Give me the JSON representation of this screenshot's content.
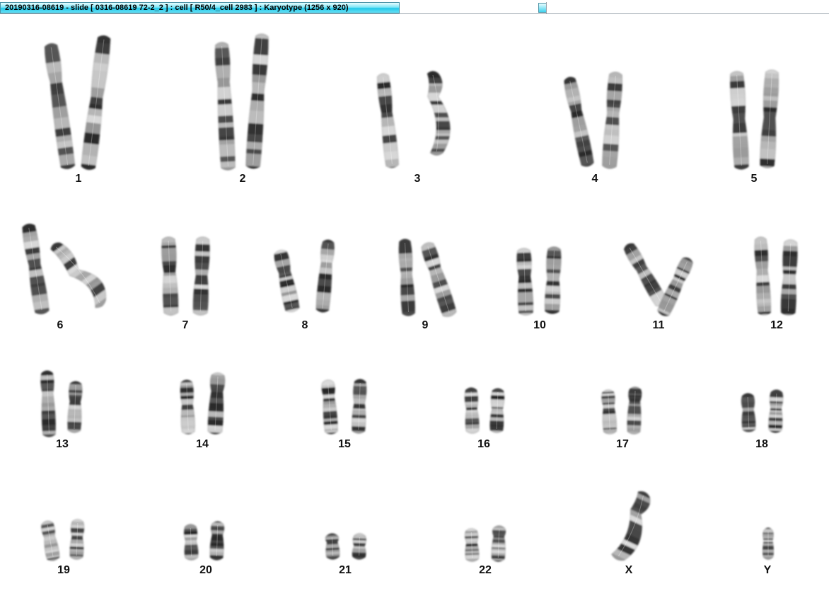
{
  "window": {
    "title": "20190316-08619 - slide [ 0316-08619 72-2_2 ] : cell [ R50/4_cell 2983 ] : Karyotype  (1256 x 920)"
  },
  "colors": {
    "titlebar_accent": "#22c9ea",
    "chromosome_ink": "#2a2a2a"
  },
  "karyotype": {
    "pairs": [
      {
        "label": "1"
      },
      {
        "label": "2"
      },
      {
        "label": "3"
      },
      {
        "label": "4"
      },
      {
        "label": "5"
      },
      {
        "label": "6"
      },
      {
        "label": "7"
      },
      {
        "label": "8"
      },
      {
        "label": "9"
      },
      {
        "label": "10"
      },
      {
        "label": "11"
      },
      {
        "label": "12"
      },
      {
        "label": "13"
      },
      {
        "label": "14"
      },
      {
        "label": "15"
      },
      {
        "label": "16"
      },
      {
        "label": "17"
      },
      {
        "label": "18"
      },
      {
        "label": "19"
      },
      {
        "label": "20"
      },
      {
        "label": "21"
      },
      {
        "label": "22"
      },
      {
        "label": "X"
      },
      {
        "label": "Y"
      }
    ]
  }
}
